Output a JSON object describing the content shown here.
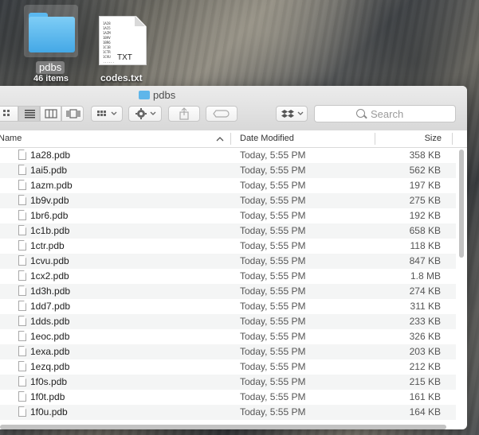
{
  "desktop": {
    "folder": {
      "label": "pdbs",
      "sublabel": "46 items"
    },
    "document": {
      "label": "codes.txt",
      "extension": "TXT",
      "preview_lines": [
        "1A28",
        "1AI5",
        "1AZM",
        "1B9V",
        "1BR6",
        "1C1B",
        "1CTR",
        "1CVU",
        "......"
      ]
    }
  },
  "window": {
    "title": "pdbs",
    "search": {
      "placeholder": "Search"
    },
    "toolbar": {
      "icons": [
        "icon-view-icon",
        "list-view-icon",
        "column-view-icon",
        "cover-flow-icon",
        "arrange-icon",
        "action-gear-icon",
        "share-icon",
        "tags-icon",
        "dropbox-icon"
      ]
    },
    "columns": {
      "name": "Name",
      "date": "Date Modified",
      "size": "Size"
    },
    "files": [
      {
        "name": "1a28.pdb",
        "date": "Today, 5:55 PM",
        "size": "358 KB"
      },
      {
        "name": "1ai5.pdb",
        "date": "Today, 5:55 PM",
        "size": "562 KB"
      },
      {
        "name": "1azm.pdb",
        "date": "Today, 5:55 PM",
        "size": "197 KB"
      },
      {
        "name": "1b9v.pdb",
        "date": "Today, 5:55 PM",
        "size": "275 KB"
      },
      {
        "name": "1br6.pdb",
        "date": "Today, 5:55 PM",
        "size": "192 KB"
      },
      {
        "name": "1c1b.pdb",
        "date": "Today, 5:55 PM",
        "size": "658 KB"
      },
      {
        "name": "1ctr.pdb",
        "date": "Today, 5:55 PM",
        "size": "118 KB"
      },
      {
        "name": "1cvu.pdb",
        "date": "Today, 5:55 PM",
        "size": "847 KB"
      },
      {
        "name": "1cx2.pdb",
        "date": "Today, 5:55 PM",
        "size": "1.8 MB"
      },
      {
        "name": "1d3h.pdb",
        "date": "Today, 5:55 PM",
        "size": "274 KB"
      },
      {
        "name": "1dd7.pdb",
        "date": "Today, 5:55 PM",
        "size": "311 KB"
      },
      {
        "name": "1dds.pdb",
        "date": "Today, 5:55 PM",
        "size": "233 KB"
      },
      {
        "name": "1eoc.pdb",
        "date": "Today, 5:55 PM",
        "size": "326 KB"
      },
      {
        "name": "1exa.pdb",
        "date": "Today, 5:55 PM",
        "size": "203 KB"
      },
      {
        "name": "1ezq.pdb",
        "date": "Today, 5:55 PM",
        "size": "212 KB"
      },
      {
        "name": "1f0s.pdb",
        "date": "Today, 5:55 PM",
        "size": "215 KB"
      },
      {
        "name": "1f0t.pdb",
        "date": "Today, 5:55 PM",
        "size": "161 KB"
      },
      {
        "name": "1f0u.pdb",
        "date": "Today, 5:55 PM",
        "size": "164 KB"
      }
    ]
  }
}
